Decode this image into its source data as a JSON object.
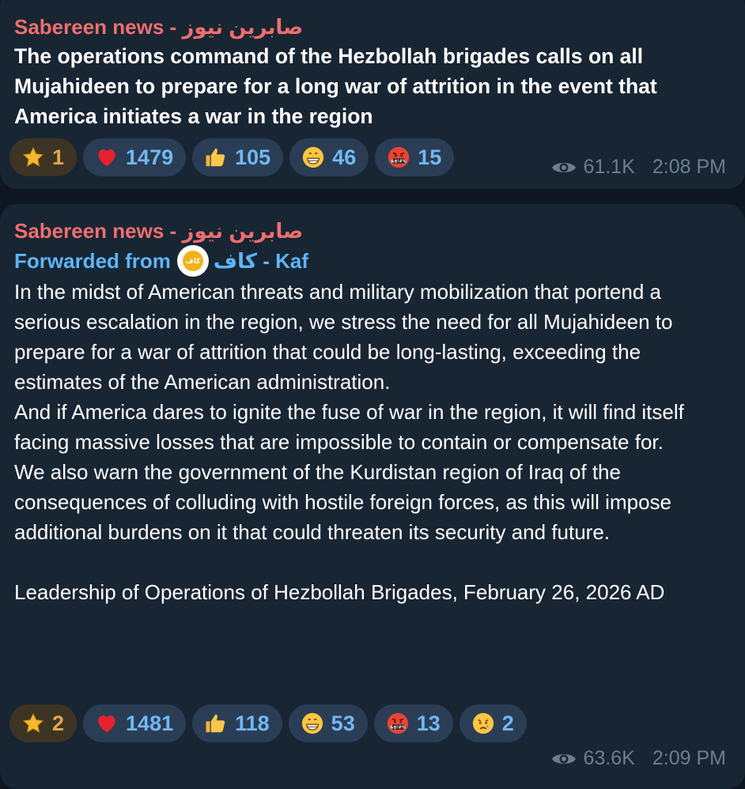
{
  "messages": [
    {
      "sender": "Sabereen news - صابرين نيوز",
      "text": "The operations command of the Hezbollah brigades calls on all Mujahideen to prepare for a long war of attrition in the event that America initiates a war in the region",
      "reactions": [
        {
          "icon": "star-icon",
          "count": "1"
        },
        {
          "icon": "red-heart-icon",
          "count": "1479"
        },
        {
          "icon": "thumbs-up-icon",
          "count": "105"
        },
        {
          "icon": "grinning-face-icon",
          "count": "46"
        },
        {
          "icon": "cursing-face-icon",
          "count": "15"
        }
      ],
      "views": "61.1K",
      "time": "2:08 PM"
    },
    {
      "sender": "Sabereen news - صابرين نيوز",
      "forwarded_label": "Forwarded from",
      "forwarded_source": "كاف - Kaf",
      "forwarded_avatar_text": "كاف",
      "paragraphs": [
        "In the midst of American threats and military mobilization that portend a serious escalation in the region, we stress the need for all Mujahideen to prepare for a war of attrition that could be long-lasting, exceeding the estimates of the American administration.",
        "And if America dares to ignite the fuse of war in the region, it will find itself facing massive losses that are impossible to contain or compensate for.",
        "We also warn the government of the Kurdistan region of Iraq of the consequences of colluding with hostile foreign forces, as this will impose additional burdens on it that could threaten its security and future.",
        "Leadership of Operations of Hezbollah Brigades, February 26, 2026 AD"
      ],
      "reactions": [
        {
          "icon": "star-icon",
          "count": "2"
        },
        {
          "icon": "red-heart-icon",
          "count": "1481"
        },
        {
          "icon": "thumbs-up-icon",
          "count": "118"
        },
        {
          "icon": "grinning-face-icon",
          "count": "53"
        },
        {
          "icon": "cursing-face-icon",
          "count": "13"
        },
        {
          "icon": "crying-face-icon",
          "count": "2"
        }
      ],
      "views": "63.6K",
      "time": "2:09 PM"
    }
  ],
  "colors": {
    "background": "#0e1621",
    "bubble": "#182533",
    "sender": "#ef6e6e",
    "forwarded": "#5eb5f7",
    "reaction_pill": "#2b3d55",
    "reaction_count": "#6fb9f3",
    "star_pill": "#3d3424",
    "star_count": "#e4a64a",
    "meta": "#6c7e91"
  }
}
